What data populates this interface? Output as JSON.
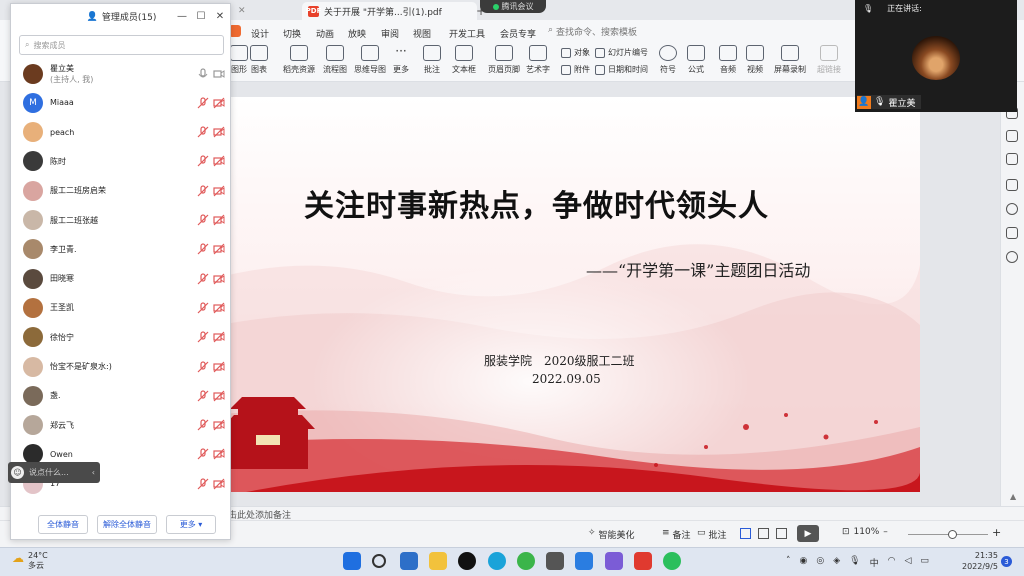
{
  "tabs": [
    {
      "label": "关于开展 \"开学第...引(1).pdf",
      "badge": "PDF"
    }
  ],
  "meeting_pill": "腾讯会议",
  "ribbon": {
    "menu": [
      "设计",
      "切换",
      "动画",
      "放映",
      "审阅",
      "视图",
      "开发工具",
      "会员专享"
    ],
    "search_placeholder": "查找命令、搜索模板",
    "buttons": [
      "图形",
      "图表",
      "稻壳资源",
      "流程图",
      "思维导图",
      "更多",
      "批注",
      "文本框",
      "页眉页脚",
      "艺术字",
      "符号",
      "公式",
      "音频",
      "视频",
      "屏幕录制",
      "超链接"
    ],
    "small_buttons": [
      "对象",
      "幻灯片编号",
      "附件",
      "日期和时间"
    ]
  },
  "slide": {
    "title": "关注时事新热点，争做时代领头人",
    "subtitle": "——“开学第一课”主题团日活动",
    "org": "服装学院　2020级服工二班",
    "date": "2022.09.05"
  },
  "notes_placeholder": "击此处添加备注",
  "status": {
    "smart_beautify": "智能美化",
    "notes": "备注",
    "comments": "批注",
    "zoom": "110%"
  },
  "video": {
    "speaking_label": "正在讲话:",
    "speaker_name": "瞿立美"
  },
  "panel": {
    "title": "管理成员(15)",
    "search_placeholder": "搜索成员",
    "members": [
      {
        "name": "瞿立美",
        "note": "(主持人, 我)",
        "color": "#6b3b1f",
        "muted": false
      },
      {
        "name": "Miaaa",
        "letter": "M",
        "color": "#2f6fe0",
        "muted": true
      },
      {
        "name": "peach",
        "color": "#e8b07a",
        "muted": true
      },
      {
        "name": "陈时",
        "color": "#3a3a3a",
        "muted": true
      },
      {
        "name": "服工二班房启荣",
        "color": "#d9a5a0",
        "muted": true
      },
      {
        "name": "服工二班张越",
        "color": "#c9b7a8",
        "muted": true
      },
      {
        "name": "李卫青.",
        "color": "#a8896b",
        "muted": true
      },
      {
        "name": "田晓寒",
        "color": "#5a4a3e",
        "muted": true
      },
      {
        "name": "王圣凯",
        "color": "#b3713f",
        "muted": true
      },
      {
        "name": "徐怡宁",
        "color": "#8c6a3a",
        "muted": true
      },
      {
        "name": "怡宝不是矿泉水:)",
        "color": "#d7b9a3",
        "muted": true
      },
      {
        "name": "盏.",
        "color": "#7a6a5a",
        "muted": true
      },
      {
        "name": "郑云飞",
        "color": "#b6a79a",
        "muted": true
      },
      {
        "name": "Owen",
        "color": "#2b2b2b",
        "muted": true
      },
      {
        "name": "17",
        "color": "#e3c4c8",
        "muted": true
      }
    ],
    "mute_all": "全体静音",
    "unmute_all": "解除全体静音",
    "more": "更多 ▾"
  },
  "chat": {
    "placeholder": "说点什么..."
  },
  "taskbar": {
    "weather_temp": "24°C",
    "weather_desc": "多云",
    "ime": "中",
    "time": "21:35",
    "date": "2022/9/5",
    "notification_count": "3"
  }
}
